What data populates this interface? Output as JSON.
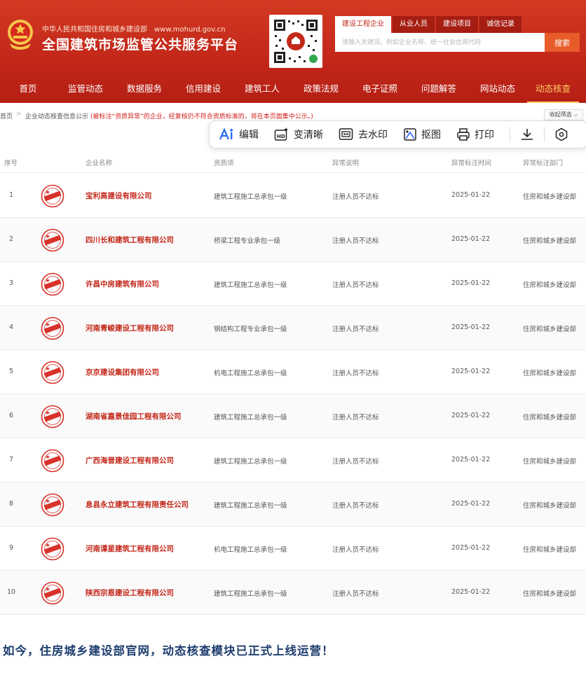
{
  "header": {
    "gov_name": "中华人民共和国住房和城乡建设部",
    "site_url": "www.mohurd.gov.cn",
    "platform_title": "全国建筑市场监管公共服务平台",
    "search_tabs": [
      "建设工程企业",
      "从业人员",
      "建设项目",
      "诚信记录"
    ],
    "search_placeholder": "请输入关键词，例如企业名称、统一社会信用代码",
    "search_button": "搜索"
  },
  "nav": {
    "items": [
      "首页",
      "监管动态",
      "数据服务",
      "信用建设",
      "建筑工人",
      "政策法规",
      "电子证照",
      "问题解答",
      "网站动态",
      "动态核查"
    ],
    "active_index": 9
  },
  "breadcrumb": {
    "home": "首页",
    "separator": ">",
    "page": "企业动态核查信息公示",
    "note": "(被标注“资质异常”的企业，经复核仍不符合资质标准的，将在本页面集中公示。)",
    "filter_button": "收起筛选 ⌵"
  },
  "toolbar": {
    "edit": "编辑",
    "enhance": "变清晰",
    "watermark": "去水印",
    "cutout": "抠图",
    "print": "打印"
  },
  "table": {
    "columns": [
      "序号",
      "企业名称",
      "资质项",
      "异常说明",
      "异常标注时间",
      "异常标注部门"
    ],
    "rows": [
      {
        "no": "1",
        "name": "宝利高建设有限公司",
        "qual": "建筑工程施工总承包一级",
        "desc": "注册人员不达标",
        "date": "2025-01-22",
        "dept": "住房和城乡建设部"
      },
      {
        "no": "2",
        "name": "四川长和建筑工程有限公司",
        "qual": "桥梁工程专业承包一级",
        "desc": "注册人员不达标",
        "date": "2025-01-22",
        "dept": "住房和城乡建设部"
      },
      {
        "no": "3",
        "name": "许昌中房建筑有限公司",
        "qual": "建筑工程施工总承包一级",
        "desc": "注册人员不达标",
        "date": "2025-01-22",
        "dept": "住房和城乡建设部"
      },
      {
        "no": "4",
        "name": "河南青峻建设工程有限公司",
        "qual": "钢结构工程专业承包一级",
        "desc": "注册人员不达标",
        "date": "2025-01-22",
        "dept": "住房和城乡建设部"
      },
      {
        "no": "5",
        "name": "京京建设集团有限公司",
        "qual": "机电工程施工总承包一级",
        "desc": "注册人员不达标",
        "date": "2025-01-22",
        "dept": "住房和城乡建设部"
      },
      {
        "no": "6",
        "name": "湖南省嘉景佳园工程有限公司",
        "qual": "建筑工程施工总承包一级",
        "desc": "注册人员不达标",
        "date": "2025-01-22",
        "dept": "住房和城乡建设部"
      },
      {
        "no": "7",
        "name": "广西海晋建设工程有限公司",
        "qual": "建筑工程施工总承包一级",
        "desc": "注册人员不达标",
        "date": "2025-01-22",
        "dept": "住房和城乡建设部"
      },
      {
        "no": "8",
        "name": "息县永立建筑工程有限责任公司",
        "qual": "建筑工程施工总承包一级",
        "desc": "注册人员不达标",
        "date": "2025-01-22",
        "dept": "住房和城乡建设部"
      },
      {
        "no": "9",
        "name": "河南谭星建筑工程有限公司",
        "qual": "机电工程施工总承包一级",
        "desc": "注册人员不达标",
        "date": "2025-01-22",
        "dept": "住房和城乡建设部"
      },
      {
        "no": "10",
        "name": "陕西宗恩建设工程有限公司",
        "qual": "建筑工程施工总承包一级",
        "desc": "注册人员不达标",
        "date": "2025-01-22",
        "dept": "住房和城乡建设部"
      }
    ]
  },
  "footer": {
    "text": "如今，住房城乡建设部官网，动态核查模块已正式上线运营！"
  },
  "colors": {
    "brand_red": "#c3281a",
    "active_nav": "#ffcc66",
    "company_name": "#c3281a",
    "footer_text": "#1e3e6e"
  }
}
